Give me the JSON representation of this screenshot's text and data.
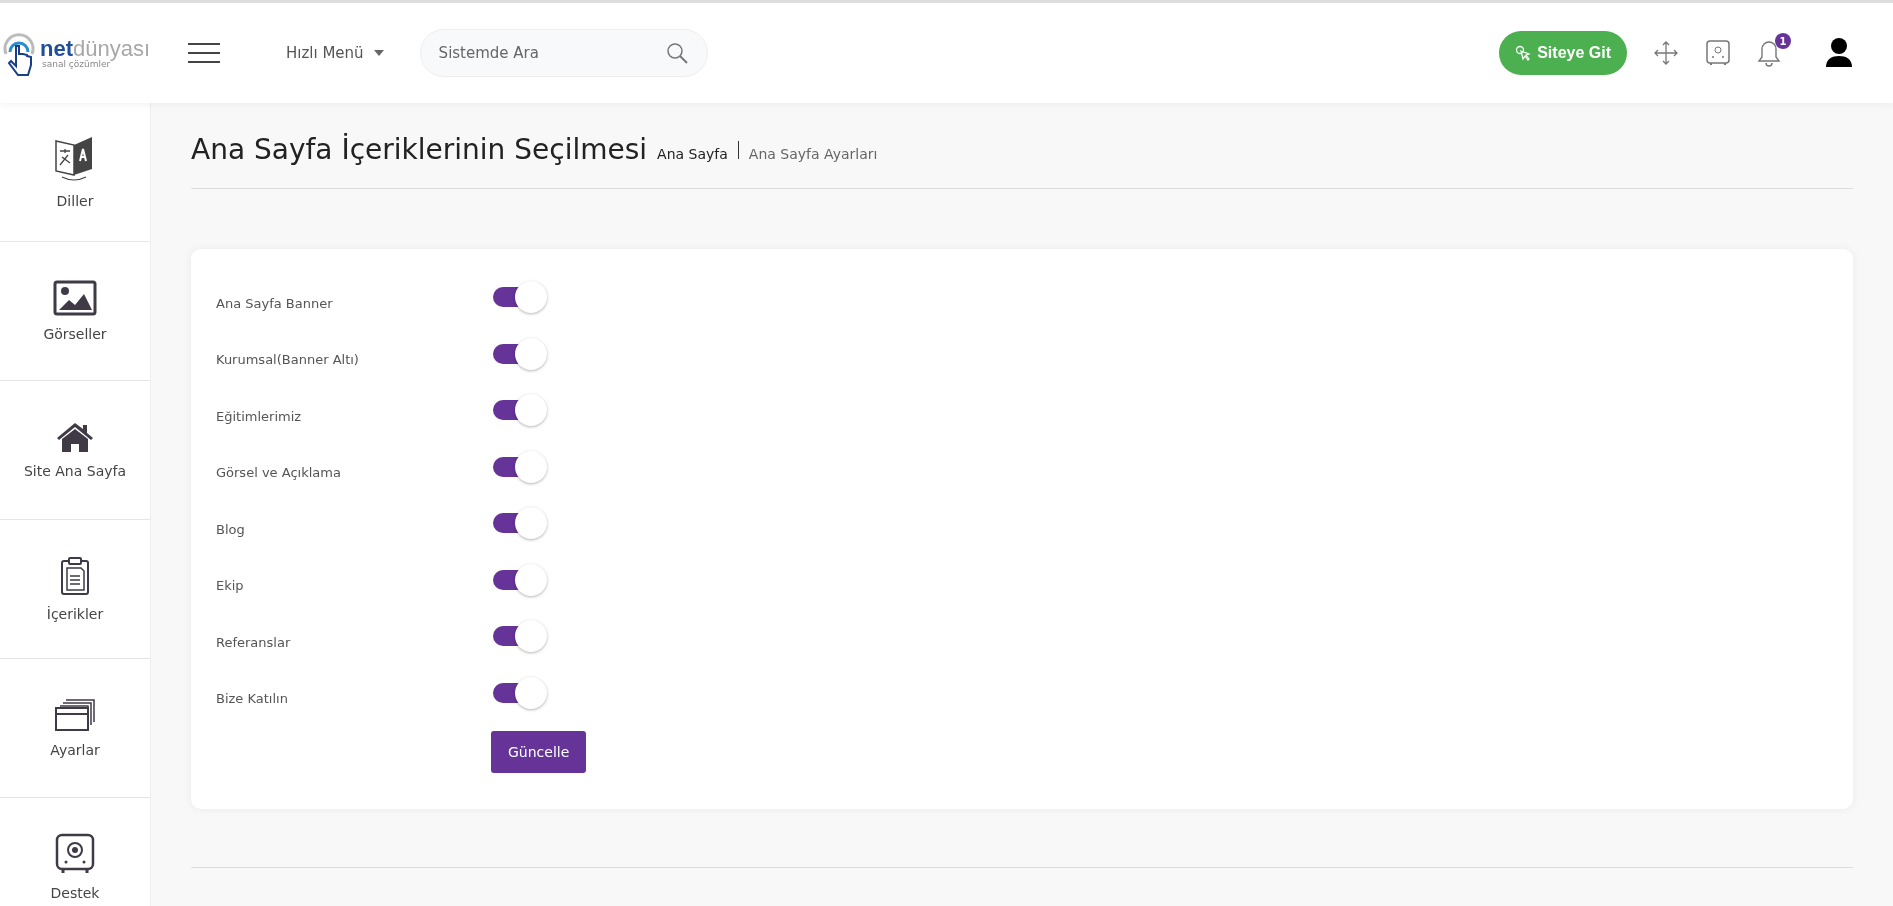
{
  "header": {
    "logo": {
      "brand_bold": "net",
      "brand_light": "dünyası",
      "tagline": "sanal çözümler"
    },
    "quick_menu": "Hızlı Menü",
    "search": {
      "placeholder": "Sistemde Ara"
    },
    "site_button": "Siteye Git",
    "notification_count": "1"
  },
  "sidebar": {
    "items": [
      {
        "label": "Diller",
        "kind": "language"
      },
      {
        "label": "Görseller",
        "kind": "image"
      },
      {
        "label": "Site Ana Sayfa",
        "kind": "home"
      },
      {
        "label": "İçerikler",
        "kind": "clipboard"
      },
      {
        "label": "Ayarlar",
        "kind": "windows"
      },
      {
        "label": "Destek",
        "kind": "safe"
      }
    ]
  },
  "page": {
    "title": "Ana Sayfa İçeriklerinin Seçilmesi",
    "breadcrumb": [
      "Ana Sayfa",
      "Ana Sayfa Ayarları"
    ]
  },
  "settings": [
    {
      "label": "Ana Sayfa Banner",
      "on": true
    },
    {
      "label": "Kurumsal(Banner Altı)",
      "on": true
    },
    {
      "label": "Eğitimlerimiz",
      "on": true
    },
    {
      "label": "Görsel ve Açıklama",
      "on": true
    },
    {
      "label": "Blog",
      "on": true
    },
    {
      "label": "Ekip",
      "on": true
    },
    {
      "label": "Referanslar",
      "on": true
    },
    {
      "label": "Bize Katılın",
      "on": true
    }
  ],
  "update_button": "Güncelle"
}
